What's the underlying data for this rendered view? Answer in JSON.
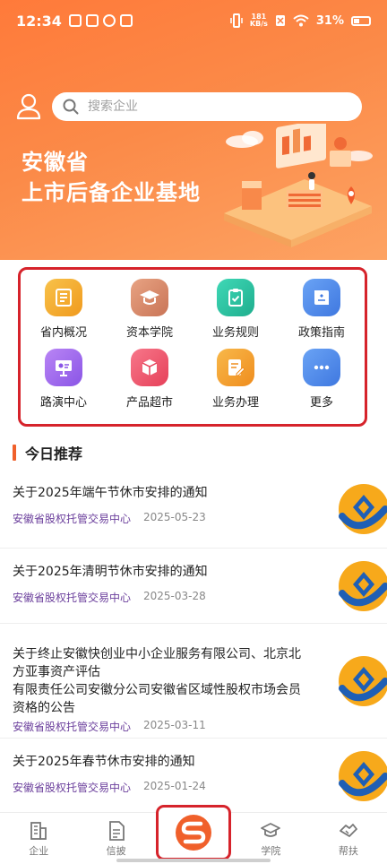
{
  "status_bar": {
    "time": "12:34",
    "net_speed_value": "181",
    "net_speed_unit": "KB/s",
    "battery": "31%"
  },
  "search": {
    "placeholder": "搜索企业"
  },
  "banner": {
    "line1": "安徽省",
    "line2": "上市后备企业基地"
  },
  "menu": [
    {
      "label": "省内概况",
      "icon": "list-doc-icon",
      "color": "#f4b02c"
    },
    {
      "label": "资本学院",
      "icon": "graduation-cap-icon",
      "color": "#d98a6a"
    },
    {
      "label": "业务规则",
      "icon": "clipboard-check-icon",
      "color": "#2cc5a5"
    },
    {
      "label": "政策指南",
      "icon": "book-icon",
      "color": "#4f8ef0"
    },
    {
      "label": "路演中心",
      "icon": "presentation-icon",
      "color": "#a36cf0"
    },
    {
      "label": "产品超市",
      "icon": "box-icon",
      "color": "#f05a6e"
    },
    {
      "label": "业务办理",
      "icon": "form-edit-icon",
      "color": "#f4a12c"
    },
    {
      "label": "更多",
      "icon": "more-dots-icon",
      "color": "#4f8ef0"
    }
  ],
  "section": {
    "title": "今日推荐"
  },
  "news": [
    {
      "title": "关于2025年端午节休市安排的通知",
      "source": "安徽省股权托管交易中心",
      "date": "2025-05-23"
    },
    {
      "title": "关于2025年清明节休市安排的通知",
      "source": "安徽省股权托管交易中心",
      "date": "2025-03-28"
    },
    {
      "title_lines": [
        "关于终止安徽快创业中小企业服务有限公司、北京北",
        "方亚事资产评估",
        "有限责任公司安徽分公司安徽省区域性股权市场会员",
        "资格的公告"
      ],
      "source": "安徽省股权托管交易中心",
      "date": "2025-03-11"
    },
    {
      "title": "关于2025年春节休市安排的通知",
      "source": "安徽省股权托管交易中心",
      "date": "2025-01-24"
    }
  ],
  "tabs": [
    {
      "label": "企业",
      "icon": "building-icon"
    },
    {
      "label": "信披",
      "icon": "document-icon"
    },
    {
      "label": "",
      "icon": "brand-logo-icon"
    },
    {
      "label": "学院",
      "icon": "graduation-cap-icon"
    },
    {
      "label": "帮扶",
      "icon": "handshake-icon"
    }
  ],
  "colors": {
    "accent": "#f0602b",
    "highlight_border": "#d6232b",
    "source_text": "#6b3f9c"
  }
}
